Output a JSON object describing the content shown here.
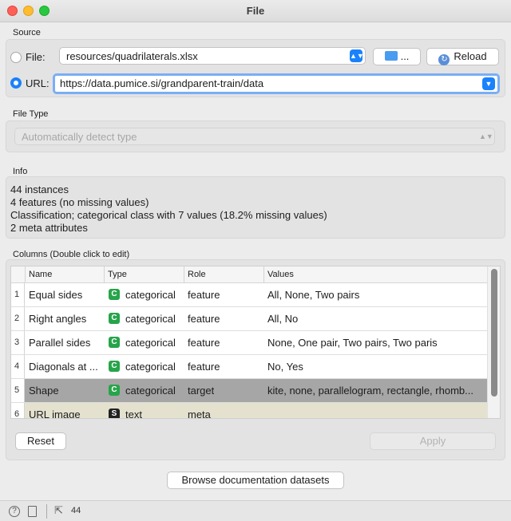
{
  "window": {
    "title": "File"
  },
  "source": {
    "label": "Source",
    "file_label": "File:",
    "file_value": "resources/quadrilaterals.xlsx",
    "browse_label": "...",
    "reload_label": "Reload",
    "url_label": "URL:",
    "url_value": "https://data.pumice.si/grandparent-train/data",
    "selected": "url"
  },
  "file_type": {
    "label": "File Type",
    "value": "Automatically detect type"
  },
  "info": {
    "label": "Info",
    "lines": [
      "44 instances",
      "4 features (no missing values)",
      "Classification; categorical class with 7 values (18.2% missing values)",
      "2 meta attributes"
    ]
  },
  "columns": {
    "label": "Columns (Double click to edit)",
    "headers": [
      "Name",
      "Type",
      "Role",
      "Values"
    ],
    "rows": [
      {
        "num": "1",
        "name": "Equal sides",
        "type_icon": "C",
        "type": "categorical",
        "role": "feature",
        "values": "All, None, Two pairs"
      },
      {
        "num": "2",
        "name": "Right angles",
        "type_icon": "C",
        "type": "categorical",
        "role": "feature",
        "values": "All, No"
      },
      {
        "num": "3",
        "name": "Parallel sides",
        "type_icon": "C",
        "type": "categorical",
        "role": "feature",
        "values": "None, One pair, Two pairs, Two paris"
      },
      {
        "num": "4",
        "name": "Diagonals at ...",
        "type_icon": "C",
        "type": "categorical",
        "role": "feature",
        "values": "No, Yes"
      },
      {
        "num": "5",
        "name": "Shape",
        "type_icon": "C",
        "type": "categorical",
        "role": "target",
        "values": "kite, none, parallelogram, rectangle, rhomb..."
      },
      {
        "num": "6",
        "name": "URL image",
        "type_icon": "S",
        "type": "text",
        "role": "meta",
        "values": ""
      }
    ]
  },
  "buttons": {
    "reset": "Reset",
    "apply": "Apply",
    "browse_docs": "Browse documentation datasets"
  },
  "statusbar": {
    "help_icon": "question-icon",
    "report_icon": "document-icon",
    "output_icon": "output-arrow-icon",
    "output_count": "44"
  },
  "colors": {
    "accent": "#1a82fb",
    "categorical_icon": "#27a44a",
    "text_icon": "#222222",
    "target_row": "#a6a6a6",
    "meta_row": "#e4e2cf"
  }
}
